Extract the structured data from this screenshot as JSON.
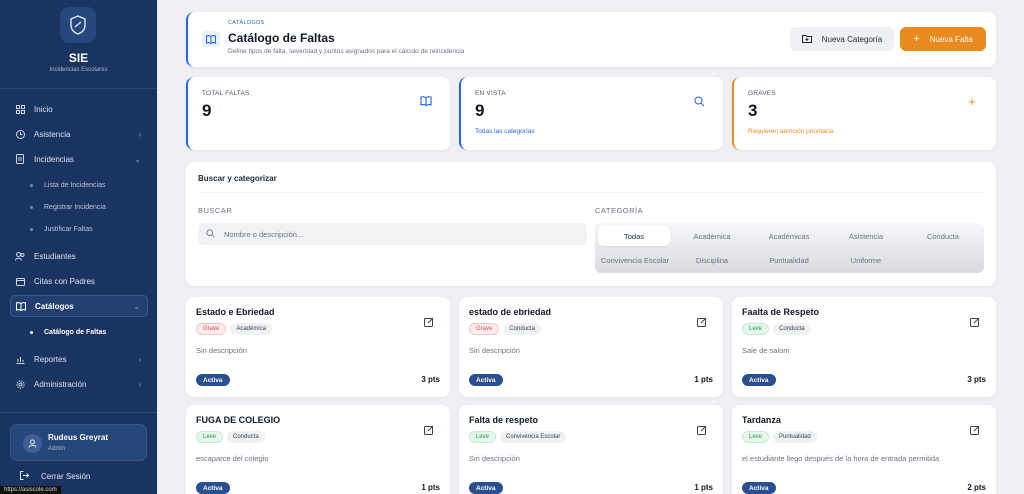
{
  "sidebar": {
    "brand_title": "SIE",
    "brand_subtitle": "Incidencias Escolares",
    "items": [
      {
        "label": "Inicio",
        "icon": "grid-icon",
        "chevron": ""
      },
      {
        "label": "Asistencia",
        "icon": "clock-icon",
        "chevron": "›"
      },
      {
        "label": "Incidencias",
        "icon": "document-icon",
        "chevron": "⌄"
      },
      {
        "label": "Estudiantes",
        "icon": "users-icon",
        "chevron": ""
      },
      {
        "label": "Citas con Padres",
        "icon": "calendar-icon",
        "chevron": ""
      },
      {
        "label": "Catálogos",
        "icon": "book-icon",
        "chevron": "⌄"
      },
      {
        "label": "Reportes",
        "icon": "chart-icon",
        "chevron": "›"
      },
      {
        "label": "Administración",
        "icon": "gear-icon",
        "chevron": "›"
      }
    ],
    "incidencias_sub": [
      "Lista de Incidencias",
      "Registrar Incidencia",
      "Justificar Faltas"
    ],
    "catalogos_sub": [
      "Catálogo de Faltas"
    ],
    "user": {
      "name": "Rudeus Greyrat",
      "role": "Admin"
    },
    "logout": "Cerrar Sesión",
    "status_url": "https://asiscole.com"
  },
  "header": {
    "kicker": "CATÁLOGOS",
    "title": "Catálogo de Faltas",
    "description": "Define tipos de falta, severidad y puntos asignados para el cálculo de reincidencia",
    "btn_secondary": "Nueva Categoría",
    "btn_primary": "Nueva Falta"
  },
  "stats": [
    {
      "label": "TOTAL FALTAS",
      "value": "9",
      "note": "",
      "icon": "book-icon",
      "color": "#2563eb"
    },
    {
      "label": "EN VISTA",
      "value": "9",
      "note": "Todas las categorías",
      "icon": "search-icon",
      "color": "#2563eb"
    },
    {
      "label": "GRAVES",
      "value": "3",
      "note": "Requieren atención prioritaria",
      "icon": "plus-icon",
      "color": "#e98a1e"
    }
  ],
  "filters": {
    "title": "Buscar y categorizar",
    "search_label": "BUSCAR",
    "search_placeholder": "Nombre o descripción...",
    "category_label": "CATEGORÍA",
    "categories_row1": [
      "Todas",
      "Académica",
      "Académicas",
      "Asistencia",
      "Conducta"
    ],
    "categories_row2": [
      "Convivencia Escolar",
      "Disciplina",
      "Puntualidad",
      "Uniforme"
    ],
    "selected": "Todas"
  },
  "faults": [
    {
      "title": "Estado e Ebriedad",
      "severity": "Grave",
      "category": "Académica",
      "description": "Sin descripción",
      "status": "Activa",
      "points": "3 pts"
    },
    {
      "title": "estado de ebriedad",
      "severity": "Grave",
      "category": "Conducta",
      "description": "Sin descripción",
      "status": "Activa",
      "points": "1 pts"
    },
    {
      "title": "Faalta de Respeto",
      "severity": "Leve",
      "category": "Conducta",
      "description": "Sale de salom",
      "status": "Activa",
      "points": "3 pts"
    },
    {
      "title": "FUGA DE COLEGIO",
      "severity": "Leve",
      "category": "Conducta",
      "description": "escaparce del colegio",
      "status": "Activa",
      "points": "1 pts"
    },
    {
      "title": "Falta de respeto",
      "severity": "Leve",
      "category": "Convivencia Escolar",
      "description": "Sin descripción",
      "status": "Activa",
      "points": "1 pts"
    },
    {
      "title": "Tardanza",
      "severity": "Leve",
      "category": "Puntualidad",
      "description": "el estudiante llego después de la hora de entrada permitida",
      "status": "Activa",
      "points": "2 pts"
    }
  ]
}
